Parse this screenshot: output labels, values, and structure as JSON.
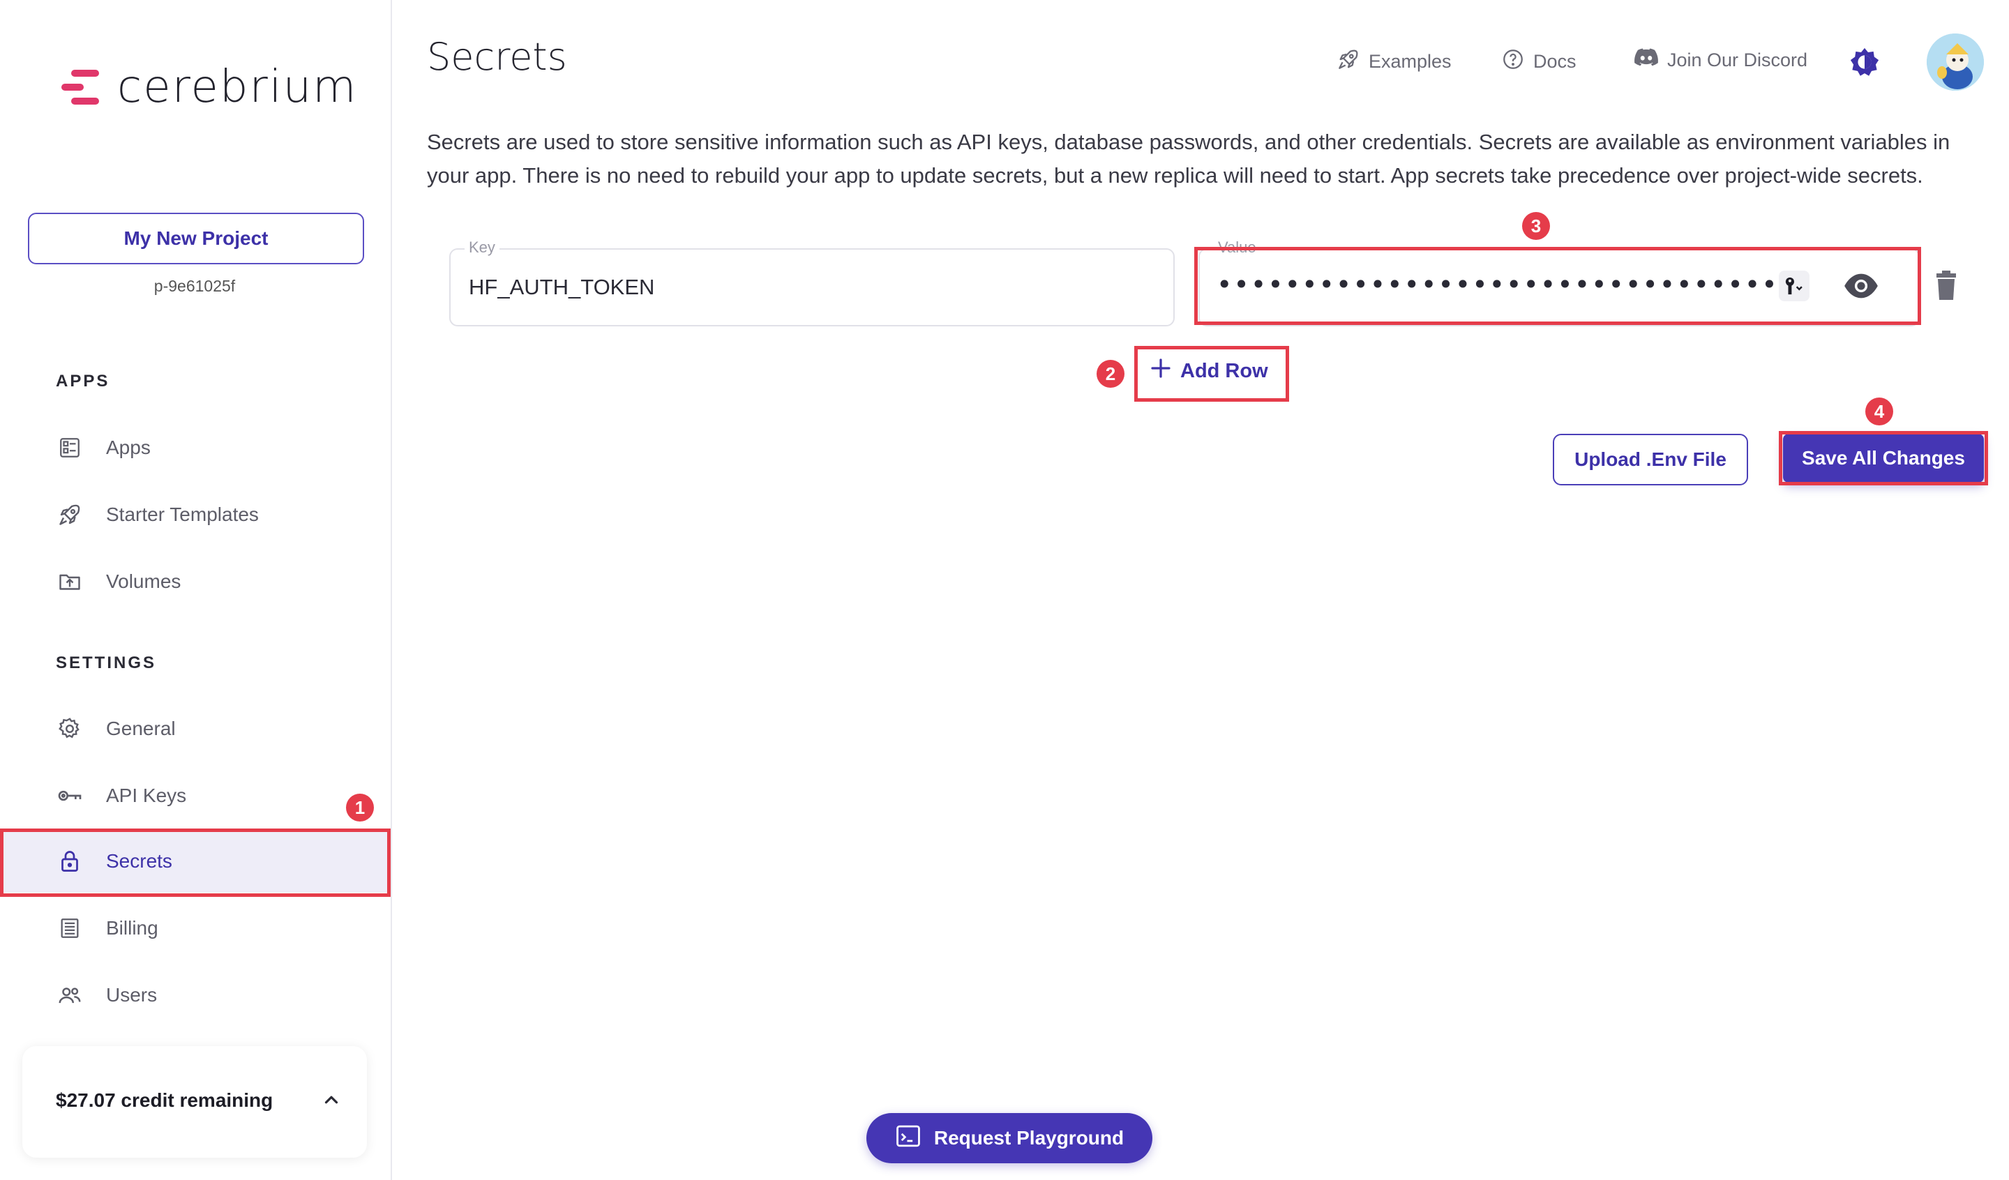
{
  "brand": {
    "name": "cerebrium",
    "accent": "#e0376a",
    "primary": "#4536b4"
  },
  "project": {
    "name": "My New Project",
    "id": "p-9e61025f"
  },
  "sidebar": {
    "apps_heading": "APPS",
    "apps_items": [
      {
        "label": "Apps",
        "icon": "apps-icon"
      },
      {
        "label": "Starter Templates",
        "icon": "rocket-icon"
      },
      {
        "label": "Volumes",
        "icon": "folder-upload-icon"
      }
    ],
    "settings_heading": "SETTINGS",
    "settings_items": [
      {
        "label": "General",
        "icon": "gear-icon"
      },
      {
        "label": "API Keys",
        "icon": "key-icon"
      },
      {
        "label": "Secrets",
        "icon": "lock-icon",
        "active": true
      },
      {
        "label": "Billing",
        "icon": "billing-icon"
      },
      {
        "label": "Users",
        "icon": "users-icon"
      }
    ],
    "credit": "$27.07 credit remaining"
  },
  "header": {
    "title": "Secrets",
    "links": [
      {
        "label": "Examples",
        "icon": "rocket-icon"
      },
      {
        "label": "Docs",
        "icon": "help-circle-icon"
      },
      {
        "label": "Join Our Discord",
        "icon": "discord-icon"
      }
    ]
  },
  "description": "Secrets are used to store sensitive information such as API keys, database passwords, and other credentials. Secrets are available as environment variables in your app. There is no need to rebuild your app to update secrets, but a new replica will need to start. App secrets take precedence over project-wide secrets.",
  "secret_row": {
    "key_label": "Key",
    "key_value": "HF_AUTH_TOKEN",
    "value_label": "Value",
    "value_masked": "••••••••••••••••••••••••••••••••••"
  },
  "actions": {
    "add_row": "Add Row",
    "upload_env": "Upload .Env File",
    "save_all": "Save All Changes",
    "request_playground": "Request Playground"
  },
  "annotations": [
    "1",
    "2",
    "3",
    "4"
  ]
}
